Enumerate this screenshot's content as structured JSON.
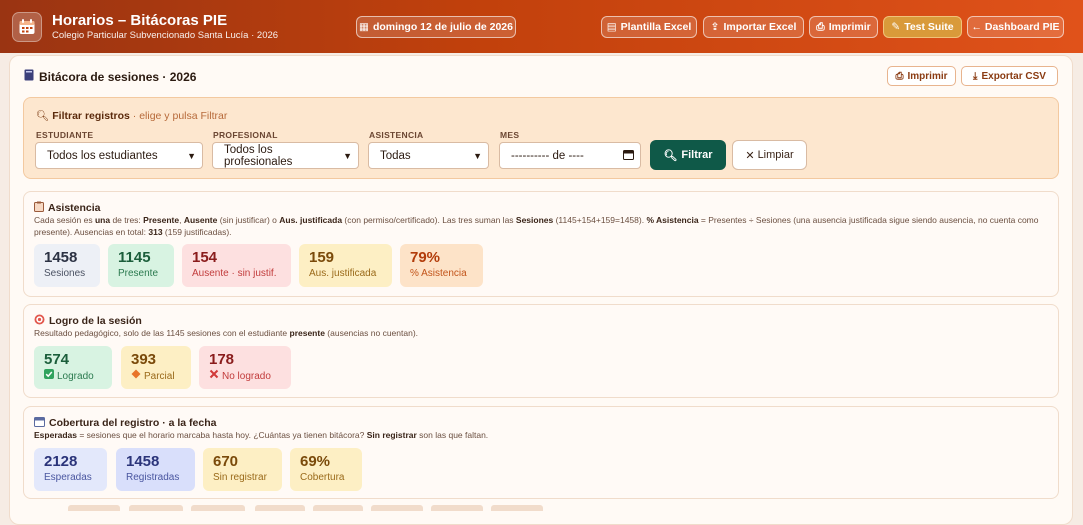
{
  "header": {
    "title": "Horarios – Bitácoras PIE",
    "subtitle": "Colegio Particular Subvencionado Santa Lucía · 2026",
    "date": "domingo 12 de julio de 2026",
    "buttons": {
      "plantilla": "Plantilla Excel",
      "importar": "Importar Excel",
      "imprimir": "Imprimir",
      "test": "Test Suite",
      "dashboard": "← Dashboard PIE"
    }
  },
  "panel": {
    "title": "Bitácora de sesiones · 2026",
    "imprimir": "Imprimir",
    "exportar": "Exportar CSV"
  },
  "filters": {
    "heading": "Filtrar registros",
    "hint": " · elige y pulsa Filtrar",
    "estudiante_label": "ESTUDIANTE",
    "estudiante_value": "Todos los estudiantes",
    "profesional_label": "PROFESIONAL",
    "profesional_value": "Todos los profesionales",
    "asistencia_label": "ASISTENCIA",
    "asistencia_value": "Todas",
    "mes_label": "MES",
    "mes_value": "---------- de ----",
    "filtrar": "Filtrar",
    "limpiar": "Limpiar"
  },
  "asistencia": {
    "title": "Asistencia",
    "desc_html": "Cada sesión es <b>una</b> de tres: <b>Presente</b>, <b>Ausente</b> (sin justificar) o <b>Aus. justificada</b> (con permiso/certificado). Las tres suman las <b>Sesiones</b> (1145+154+159=1458). <b>% Asistencia</b> = Presentes ÷ Sesiones (una ausencia justificada sigue siendo ausencia, no cuenta como presente). Ausencias en total: <b>313</b> (159 justificadas).",
    "cards": [
      {
        "value": "1458",
        "label": "Sesiones"
      },
      {
        "value": "1145",
        "label": "Presente"
      },
      {
        "value": "154",
        "label": "Ausente · sin justif."
      },
      {
        "value": "159",
        "label": "Aus. justificada"
      },
      {
        "value": "79%",
        "label": "% Asistencia"
      }
    ]
  },
  "logro": {
    "title": "Logro de la sesión",
    "desc_html": "Resultado pedagógico, solo de las 1145 sesiones con el estudiante <b>presente</b> (ausencias no cuentan).",
    "cards": [
      {
        "value": "574",
        "label": "Logrado"
      },
      {
        "value": "393",
        "label": "Parcial"
      },
      {
        "value": "178",
        "label": "No logrado"
      }
    ]
  },
  "cobertura": {
    "title": "Cobertura del registro · a la fecha",
    "desc_html": "<b>Esperadas</b> = sesiones que el horario marcaba hasta hoy. ¿Cuántas ya tienen bitácora? <b>Sin registrar</b> son las que faltan.",
    "cards": [
      {
        "value": "2128",
        "label": "Esperadas"
      },
      {
        "value": "1458",
        "label": "Registradas"
      },
      {
        "value": "670",
        "label": "Sin registrar"
      },
      {
        "value": "69%",
        "label": "Cobertura"
      }
    ]
  }
}
